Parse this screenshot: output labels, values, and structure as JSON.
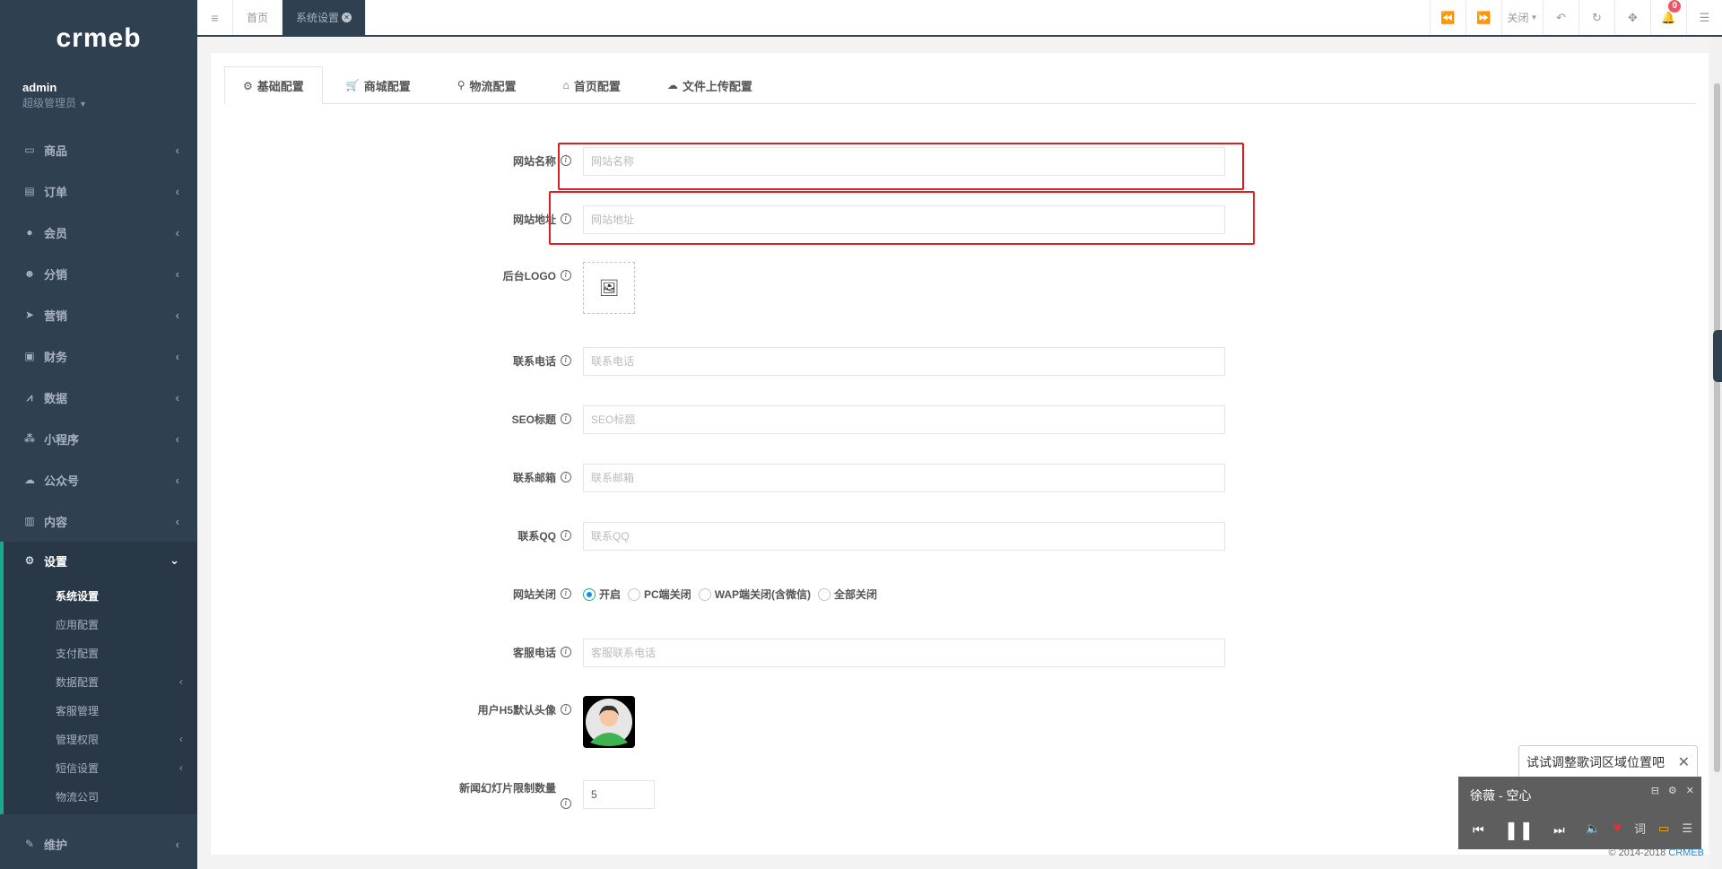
{
  "logo": "crmeb",
  "user": {
    "name": "admin",
    "role": "超级管理员"
  },
  "sidebar": {
    "items": [
      {
        "icon": "laptop-icon",
        "glyph": "▭",
        "label": "商品"
      },
      {
        "icon": "file-icon",
        "glyph": "▤",
        "label": "订单"
      },
      {
        "icon": "user-icon",
        "glyph": "●",
        "label": "会员"
      },
      {
        "icon": "users-icon",
        "glyph": "☻",
        "label": "分销"
      },
      {
        "icon": "paper-plane-icon",
        "glyph": "➤",
        "label": "营销"
      },
      {
        "icon": "money-icon",
        "glyph": "▣",
        "label": "财务"
      },
      {
        "icon": "chart-icon",
        "glyph": "⩘",
        "label": "数据"
      },
      {
        "icon": "cubes-icon",
        "glyph": "⁂",
        "label": "小程序"
      },
      {
        "icon": "wechat-icon",
        "glyph": "☁",
        "label": "公众号"
      },
      {
        "icon": "book-icon",
        "glyph": "▥",
        "label": "内容"
      }
    ],
    "active": {
      "icon": "gear-icon",
      "glyph": "⚙",
      "label": "设置"
    },
    "sub_items": [
      {
        "label": "系统设置",
        "has_arrow": false
      },
      {
        "label": "应用配置",
        "has_arrow": false
      },
      {
        "label": "支付配置",
        "has_arrow": false
      },
      {
        "label": "数据配置",
        "has_arrow": true
      },
      {
        "label": "客服管理",
        "has_arrow": false
      },
      {
        "label": "管理权限",
        "has_arrow": true
      },
      {
        "label": "短信设置",
        "has_arrow": true
      },
      {
        "label": "物流公司",
        "has_arrow": false
      }
    ],
    "bottom": {
      "icon": "wrench-icon",
      "glyph": "✎",
      "label": "维护"
    }
  },
  "topbar": {
    "tabs": [
      {
        "label": "首页"
      },
      {
        "label": "系统设置"
      }
    ],
    "close_label": "关闭",
    "notification_count": "0"
  },
  "form_tabs": [
    {
      "icon": "gear-icon",
      "glyph": "⚙",
      "label": "基础配置"
    },
    {
      "icon": "cart-icon",
      "glyph": "🛒",
      "label": "商城配置"
    },
    {
      "icon": "motorcycle-icon",
      "glyph": "⚲",
      "label": "物流配置"
    },
    {
      "icon": "home-icon",
      "glyph": "⌂",
      "label": "首页配置"
    },
    {
      "icon": "cloud-upload-icon",
      "glyph": "☁",
      "label": "文件上传配置"
    }
  ],
  "form": {
    "site_name": {
      "label": "网站名称",
      "placeholder": "网站名称"
    },
    "site_url": {
      "label": "网站地址",
      "placeholder": "网站地址"
    },
    "logo": {
      "label": "后台LOGO"
    },
    "phone": {
      "label": "联系电话",
      "placeholder": "联系电话"
    },
    "seo_title": {
      "label": "SEO标题",
      "placeholder": "SEO标题"
    },
    "email": {
      "label": "联系邮箱",
      "placeholder": "联系邮箱"
    },
    "qq": {
      "label": "联系QQ",
      "placeholder": "联系QQ"
    },
    "site_close": {
      "label": "网站关闭",
      "options": [
        "开启",
        "PC端关闭",
        "WAP端关闭(含微信)",
        "全部关闭"
      ],
      "selected": "开启"
    },
    "service_phone": {
      "label": "客服电话",
      "placeholder": "客服联系电话"
    },
    "h5_avatar": {
      "label": "用户H5默认头像"
    },
    "news_slide_limit": {
      "label": "新闻幻灯片限制数量",
      "value": "5"
    }
  },
  "music_player": {
    "tip": "试试调整歌词区域位置吧",
    "song": "徐薇 - 空心",
    "lyrics_button": "词"
  },
  "footer": {
    "copyright": "© 2014-2018",
    "link": "CRMEB"
  },
  "colors": {
    "sidebar_bg": "#2f4050",
    "accent": "#19aa8d",
    "highlight_box": "#e02020",
    "radio_checked": "#1e88e5"
  }
}
